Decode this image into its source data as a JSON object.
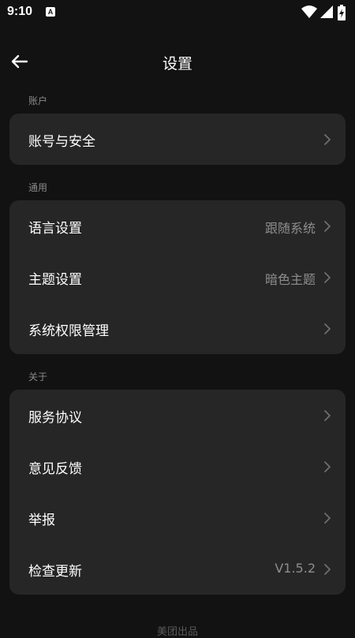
{
  "status_bar": {
    "time": "9:10",
    "notification_letter": "A"
  },
  "header": {
    "title": "设置"
  },
  "sections": {
    "account": {
      "label": "账户",
      "items": [
        {
          "label": "账号与安全",
          "value": ""
        }
      ]
    },
    "general": {
      "label": "通用",
      "items": [
        {
          "label": "语言设置",
          "value": "跟随系统"
        },
        {
          "label": "主题设置",
          "value": "暗色主题"
        },
        {
          "label": "系统权限管理",
          "value": ""
        }
      ]
    },
    "about": {
      "label": "关于",
      "items": [
        {
          "label": "服务协议",
          "value": ""
        },
        {
          "label": "意见反馈",
          "value": ""
        },
        {
          "label": "举报",
          "value": ""
        },
        {
          "label": "检查更新",
          "value": "V1.5.2"
        }
      ]
    }
  },
  "footer": {
    "text": "美团出品"
  },
  "icons": {
    "back": "arrow-left-icon",
    "chevron": "chevron-right-icon",
    "wifi": "wifi-icon",
    "signal": "signal-icon",
    "battery": "battery-charging-icon"
  },
  "colors": {
    "background": "#121212",
    "card": "#262626",
    "secondary_text": "#8d8d8d"
  }
}
